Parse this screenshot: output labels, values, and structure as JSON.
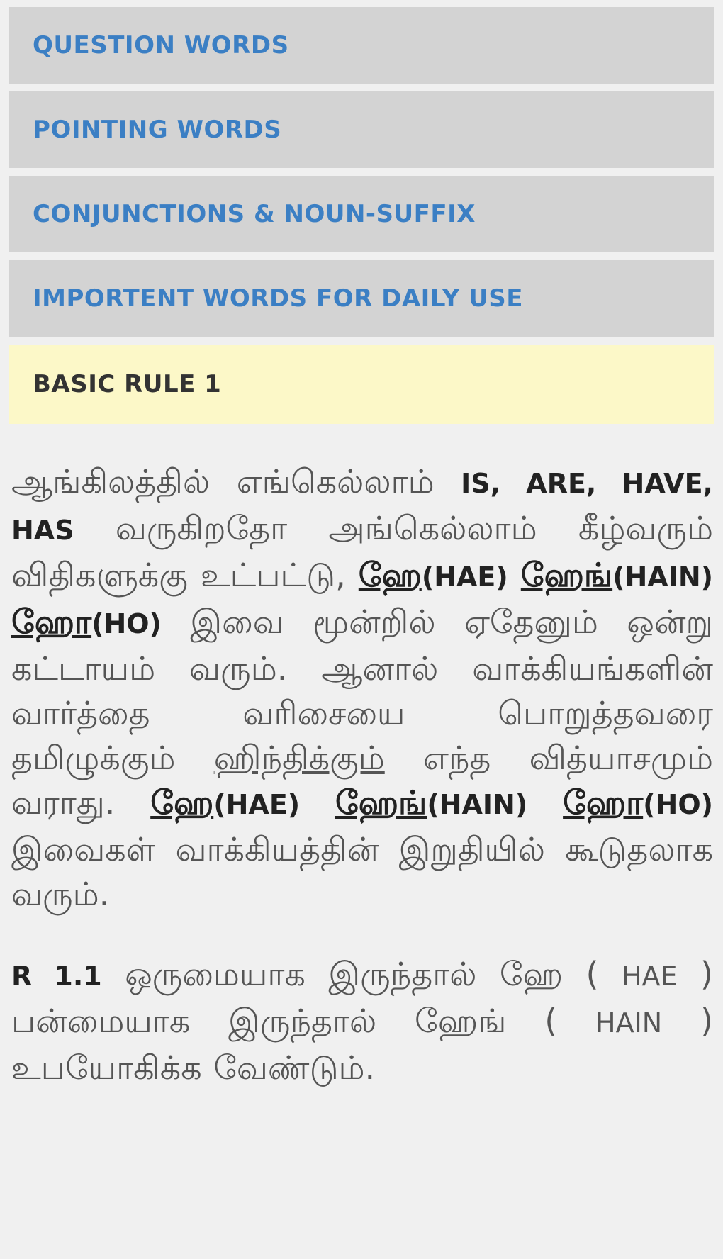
{
  "menu": {
    "items": [
      {
        "label": "QUESTION WORDS"
      },
      {
        "label": "POINTING WORDS"
      },
      {
        "label": "CONJUNCTIONS & NOUN-SUFFIX"
      },
      {
        "label": "IMPORTENT WORDS FOR DAILY USE"
      }
    ],
    "active": {
      "label": "BASIC RULE 1"
    }
  },
  "content": {
    "p1": {
      "t1": "ஆங்கிலத்தில் எங்கெல்லாம் ",
      "b1": "IS, ARE, HAVE, HAS",
      "t2": " வருகிறதோ அங்கெல்லாம் கீழ்வரும் விதிகளுக்கு உட்பட்டு, ",
      "k1": "ஹே",
      "k1l": "(HAE)",
      "k2": "ஹேங்",
      "k2l": "(HAIN)",
      "k3": "ஹோ",
      "k3l": "(HO)",
      "t3": " இவை மூன்றில் ஏதேனும் ஒன்று கட்டாயம் வரும். ஆனால் வாக்கியங்களின் வார்த்தை வரிசையை பொறுத்தவரை தமிழுக்கும் ",
      "hindi": "ஹிந்திக்கும்",
      "t4": " எந்த வித்யாசமும் வராது. ",
      "k4": "ஹே",
      "k4l": "(HAE)",
      "k5": "ஹேங்",
      "k5l": "(HAIN)",
      "k6": "ஹோ",
      "k6l": "(HO)",
      "t5": " இவைகள் வாக்கியத்தின் இறுதியில் கூடுதலாக வரும்."
    },
    "p2": {
      "rule": "R 1.1",
      "t1": " ஒருமையாக இருந்தால் ஹே ( ",
      "l1": "HAE",
      "t2": " ) பன்மையாக இருந்தால் ஹேங் ( ",
      "l2": "HAIN",
      "t3": " ) உபயோகிக்க வேண்டும்."
    }
  }
}
